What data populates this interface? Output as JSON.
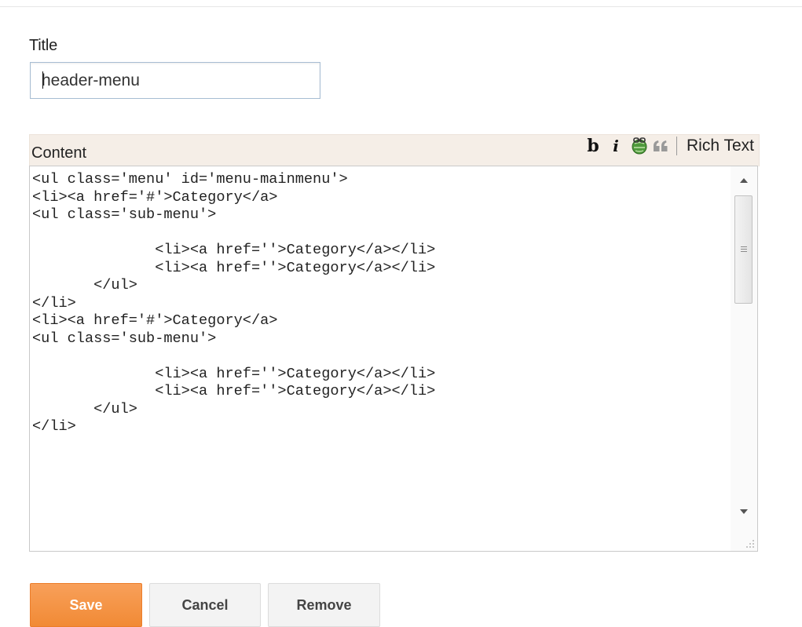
{
  "title_field": {
    "label": "Title",
    "value": "header-menu"
  },
  "content": {
    "label": "Content",
    "toolbar": {
      "bold_label": "b",
      "italic_label": "i",
      "link_icon": "link-icon",
      "quote_icon": "quote-icon",
      "mode_label": "Rich Text"
    },
    "code": "<ul class='menu' id='menu-mainmenu'>\n<li><a href='#'>Category</a>\n<ul class='sub-menu'>\n\n              <li><a href=''>Category</a></li>\n              <li><a href=''>Category</a></li>\n       </ul>\n</li>\n<li><a href='#'>Category</a>\n<ul class='sub-menu'>\n\n              <li><a href=''>Category</a></li>\n              <li><a href=''>Category</a></li>\n       </ul>\n</li>"
  },
  "buttons": {
    "save": "Save",
    "cancel": "Cancel",
    "remove": "Remove"
  },
  "colors": {
    "save_button": "#f18a35",
    "content_header_bg": "#f5eee7",
    "input_border": "#a7bdd3"
  }
}
